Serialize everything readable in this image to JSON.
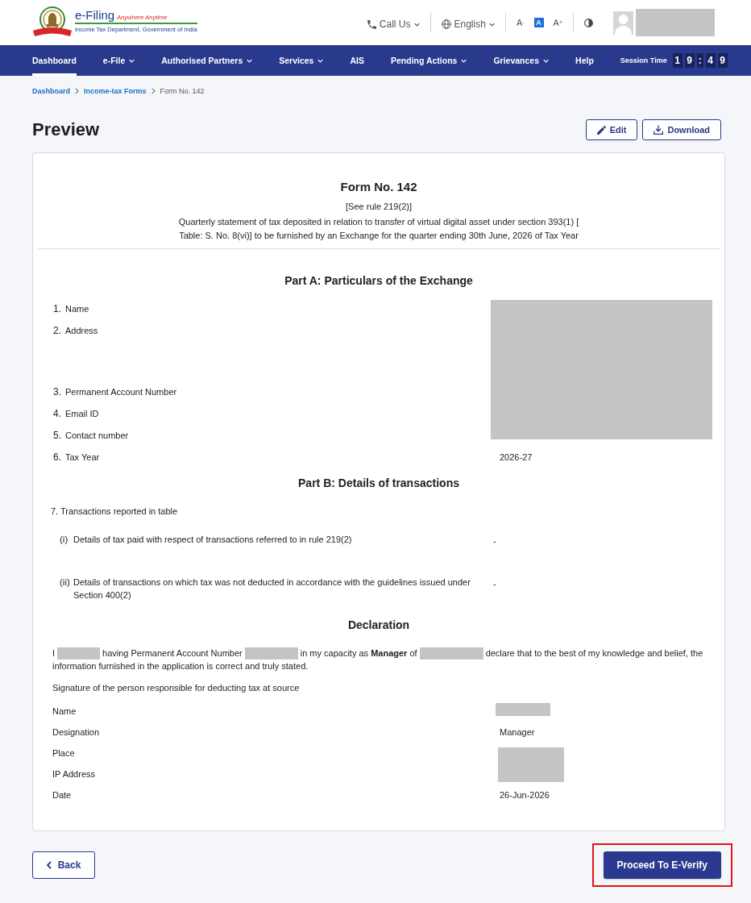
{
  "header": {
    "logo": {
      "title": "e-Filing",
      "tagline": "Anywhere Anytime",
      "department": "Income Tax Department, Government of India"
    },
    "call_us": {
      "label": "Call Us"
    },
    "language": {
      "label": "English"
    },
    "font_sizes": [
      {
        "label": "A$^{-}$",
        "selected": false
      },
      {
        "label": "A",
        "selected": true
      },
      {
        "label": "A$^{+}$",
        "selected": false
      }
    ],
    "account": {
      "name_redacted": true
    }
  },
  "nav": {
    "items": [
      {
        "label": "Dashboard",
        "selected": true,
        "has_menu": false
      },
      {
        "label": "e-File",
        "selected": false,
        "has_menu": true
      },
      {
        "label": "Authorised Partners",
        "selected": false,
        "has_menu": true
      },
      {
        "label": "Services",
        "selected": false,
        "has_menu": true
      },
      {
        "label": "AIS",
        "selected": false,
        "has_menu": false
      },
      {
        "label": "Pending Actions",
        "selected": false,
        "has_menu": true
      },
      {
        "label": "Grievances",
        "selected": false,
        "has_menu": true
      },
      {
        "label": "Help",
        "selected": false,
        "has_menu": false
      }
    ],
    "session_time": {
      "label": "Session Time",
      "hours": [
        "1",
        "9"
      ],
      "separator": ":",
      "minutes": [
        "4",
        "9"
      ]
    }
  },
  "breadcrumb": [
    {
      "label": "Dashboard",
      "current": false
    },
    {
      "label": "Income-tax Forms",
      "current": false
    },
    {
      "label": "Form No. 142",
      "current": true
    }
  ],
  "page": {
    "title": "Preview",
    "actions": [
      {
        "kind": "edit",
        "label": "Edit"
      },
      {
        "kind": "download",
        "label": "Download"
      }
    ]
  },
  "form": {
    "title": "Form No. 142",
    "rule": "[See rule 219(2)]",
    "description": "Quarterly statement of tax deposited in relation to transfer of virtual digital asset under section 393(1) [ Table: S. No. 8(vi)] to be furnished by an Exchange for the quarter ending 30th June, 2026 of Tax Year",
    "part_a": {
      "heading": "Part A: Particulars of the Exchange",
      "rows": [
        {
          "number": "1.",
          "label": "Name",
          "redacted": true
        },
        {
          "number": "2.",
          "label": "Address",
          "redacted": true
        },
        {
          "number": "3.",
          "label": "Permanent Account Number",
          "redacted": true
        },
        {
          "number": "4.",
          "label": "Email ID",
          "redacted": true
        },
        {
          "number": "5.",
          "label": "Contact number",
          "redacted": true
        },
        {
          "number": "6.",
          "label": "Tax Year",
          "redacted": false,
          "value": "2026-27"
        }
      ]
    },
    "part_b": {
      "heading": "Part B: Details of transactions",
      "intro": "7. Transactions reported in table",
      "items": [
        {
          "number": "(i)",
          "label": "Details of tax paid with respect of transactions referred to in rule 219(2)",
          "value": "-"
        },
        {
          "number": "(ii)",
          "label": "Details of transactions on which tax was not deducted in accordance with the guidelines issued under Section 400(2)",
          "value": "-"
        }
      ]
    },
    "declaration": {
      "heading": "Declaration",
      "statement_lines": [
        [
          {
            "kind": "text",
            "text": "I"
          },
          {
            "kind": "redacted"
          },
          {
            "kind": "text",
            "text": "having Permanent Account Number"
          },
          {
            "kind": "redacted"
          },
          {
            "kind": "text",
            "text": "in my capacity as **Manager** of"
          },
          {
            "kind": "redacted"
          },
          {
            "kind": "text",
            "text": "declare that to the best of my knowledge and belief, the"
          }
        ],
        [
          {
            "kind": "text",
            "text": "information furnished in the application is correct and truly stated."
          }
        ]
      ],
      "signature_note": "Signature of the person responsible for deducting tax at source",
      "rows": [
        {
          "label": "Name",
          "redacted": true
        },
        {
          "label": "Designation",
          "redacted": false,
          "value": "Manager"
        },
        {
          "label": "Place",
          "redacted": true
        },
        {
          "label": "IP Address",
          "redacted": true
        },
        {
          "label": "Date",
          "redacted": false,
          "value": "26-Jun-2026"
        }
      ]
    }
  },
  "actions": {
    "back": {
      "label": "Back"
    },
    "proceed": {
      "label": "Proceed To E-Verify",
      "highlighted": true
    }
  }
}
